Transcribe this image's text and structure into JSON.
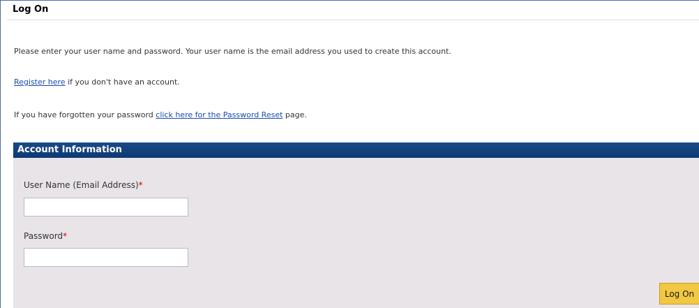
{
  "page": {
    "title": "Log On"
  },
  "intro": {
    "instructions": "Please enter your user name and password. Your user name is the email address you used to create this account.",
    "register_link": "Register here",
    "register_suffix": " if you don't have an account.",
    "reset_prefix": "If you have forgotten your password ",
    "reset_link": "click here for the Password Reset",
    "reset_suffix": " page."
  },
  "account": {
    "header": "Account Information",
    "username_label": "User Name (Email Address)",
    "password_label": "Password",
    "required_marker": "*",
    "username_value": "",
    "password_value": "",
    "logon_label": "Log On"
  },
  "colors": {
    "panel_header": "#0c3a75",
    "panel_background": "#e8e4e8",
    "button": "#f2c842",
    "link": "#1a4db0",
    "required": "#cc0000"
  }
}
